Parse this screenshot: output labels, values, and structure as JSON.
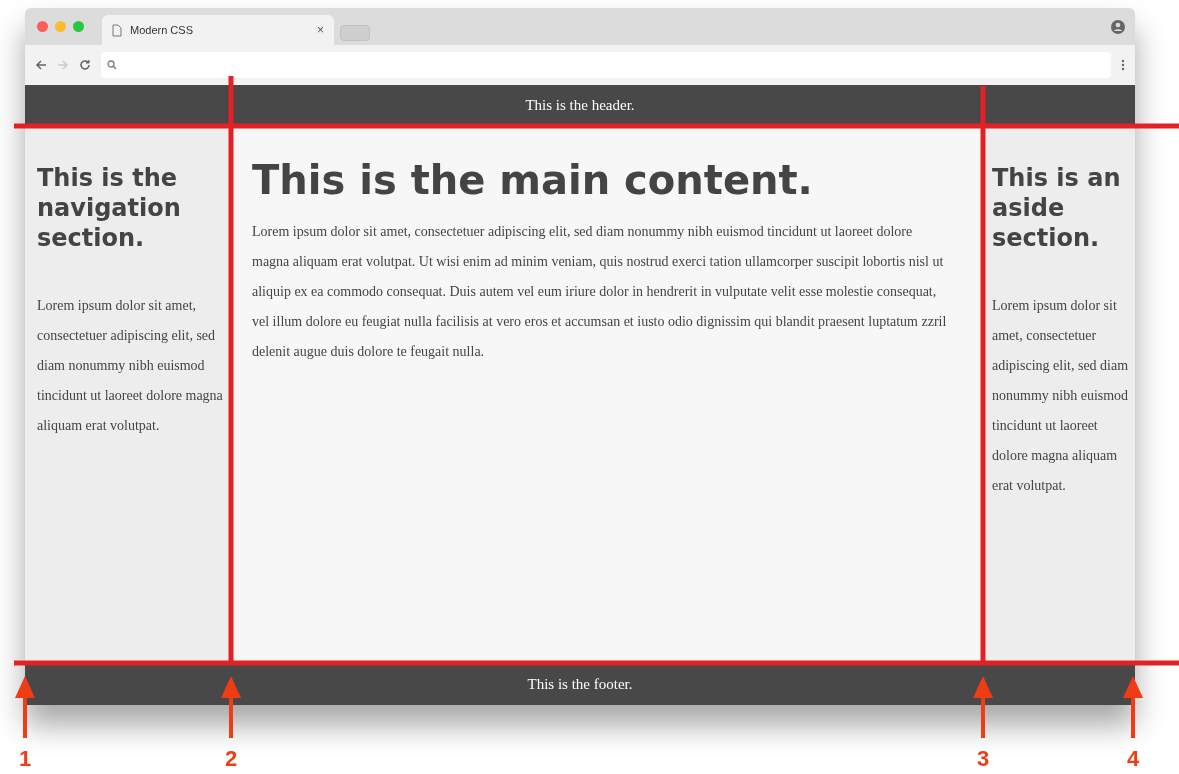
{
  "browser": {
    "tab": {
      "title": "Modern CSS",
      "close": "×"
    }
  },
  "page": {
    "header": "This is the header.",
    "nav": {
      "heading": "This is the navigation section.",
      "text": "Lorem ipsum dolor sit amet, consectetuer adipiscing elit, sed diam nonummy nibh euismod tincidunt ut laoreet dolore magna aliquam erat volutpat."
    },
    "main": {
      "heading": "This is the main content.",
      "text": "Lorem ipsum dolor sit amet, consectetuer adipiscing elit, sed diam nonummy nibh euismod tincidunt ut laoreet dolore magna aliquam erat volutpat. Ut wisi enim ad minim veniam, quis nostrud exerci tation ullamcorper suscipit lobortis nisl ut aliquip ex ea commodo consequat. Duis autem vel eum iriure dolor in hendrerit in vulputate velit esse molestie consequat, vel illum dolore eu feugiat nulla facilisis at vero eros et accumsan et iusto odio dignissim qui blandit praesent luptatum zzril delenit augue duis dolore te feugait nulla."
    },
    "aside": {
      "heading": "This is an aside section.",
      "text": "Lorem ipsum dolor sit amet, consectetuer adipiscing elit, sed diam nonummy nibh euismod tincidunt ut laoreet dolore magna aliquam erat volutpat."
    },
    "footer": "This is the footer."
  },
  "annotations": [
    {
      "label": "1"
    },
    {
      "label": "2"
    },
    {
      "label": "3"
    },
    {
      "label": "4"
    }
  ]
}
